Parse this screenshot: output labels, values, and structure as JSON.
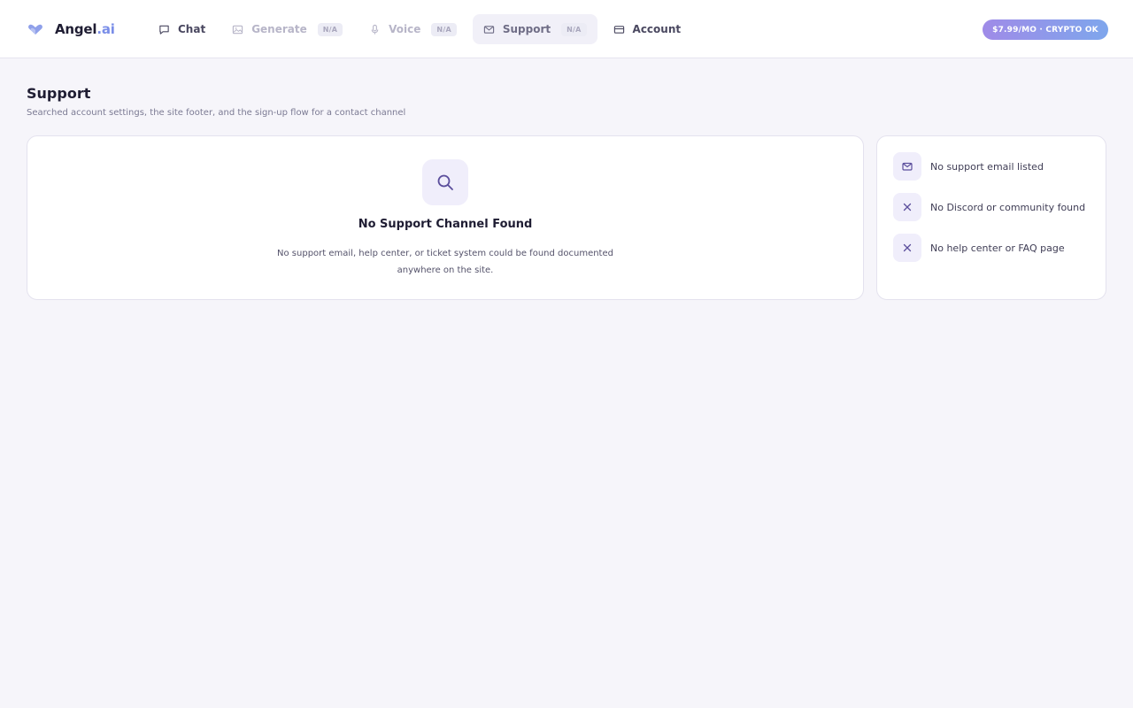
{
  "app": {
    "brand_name": "Angel",
    "brand_suffix": ".ai",
    "logo_icon": "heart-wings-icon"
  },
  "nav": {
    "items": [
      {
        "label": "Chat",
        "icon": "chat-bubble-icon",
        "badge": "",
        "state": "enabled"
      },
      {
        "label": "Generate",
        "icon": "image-icon",
        "badge": "N/A",
        "state": "disabled"
      },
      {
        "label": "Voice",
        "icon": "microphone-icon",
        "badge": "N/A",
        "state": "disabled"
      },
      {
        "label": "Support",
        "icon": "mail-icon",
        "badge": "N/A",
        "state": "active"
      },
      {
        "label": "Account",
        "icon": "credit-card-icon",
        "badge": "",
        "state": "enabled"
      }
    ]
  },
  "pricing": {
    "label": "$7.99/MO · CRYPTO OK"
  },
  "page": {
    "title": "Support",
    "subtitle": "Searched account settings, the site footer, and the sign-up flow for a contact channel"
  },
  "empty_state": {
    "icon": "search-icon",
    "title": "No Support Channel Found",
    "body": "No support email, help center, or ticket system could be found documented anywhere on the site."
  },
  "checklist": [
    {
      "icon": "mail-icon",
      "text": "No support email listed"
    },
    {
      "icon": "x-icon",
      "text": "No Discord or community found"
    },
    {
      "icon": "x-icon",
      "text": "No help center or FAQ page"
    }
  ],
  "colors": {
    "accent": "#6f5fb3",
    "brand_accent": "#7a8ee8",
    "pill_gradient_start": "#9f8be8",
    "pill_gradient_end": "#7ea6ec",
    "background": "#f6f5fa"
  }
}
